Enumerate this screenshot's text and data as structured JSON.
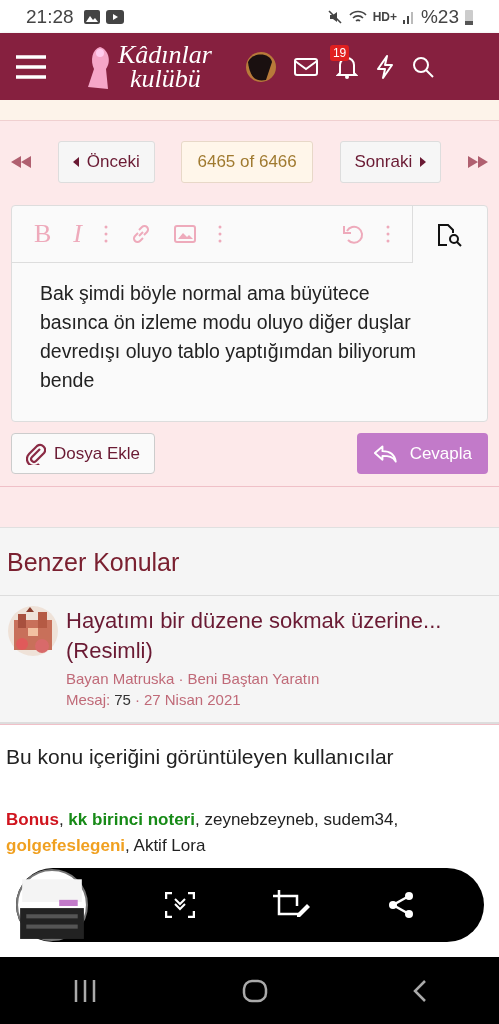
{
  "status_bar": {
    "time": "21:28",
    "network": "HD+",
    "battery": "%23"
  },
  "header": {
    "logo_line_1": "Kâdınlar",
    "logo_line_2": "kulübü",
    "notification_count": "19"
  },
  "pager": {
    "previous": "Önceki",
    "position": "6465 of 6466",
    "next": "Sonraki"
  },
  "editor": {
    "bold": "B",
    "italic": "I",
    "text": "Bak şimdi böyle normal ama büyütece basınca ön izleme modu oluyo diğer duşlar devredışı oluyo tablo yaptığımdan biliyorum bende",
    "attach": "Dosya Ekle",
    "reply": "Cevapla"
  },
  "similar": {
    "title": "Benzer Konular",
    "items": [
      {
        "kind": "picture",
        "title": "Hayatımı bir düzene sokmak üzerine... (Resimli)",
        "author": "Bayan Matruska",
        "separator_1": "·",
        "forum": "Beni Baştan Yaratın",
        "messages_label": "Mesaj:",
        "messages": "75",
        "separator_2": "·",
        "date": "27 Nisan 2021"
      }
    ]
  },
  "viewers": {
    "title": "Bu konu içeriğini görüntüleyen kullanıcılar",
    "users": [
      {
        "name": "Bonus",
        "color": "#d0141e",
        "separator": ","
      },
      {
        "name": "kk birinci noteri",
        "color": "#178a17",
        "separator": ","
      },
      {
        "name": "zeynebzeyneb",
        "color": "#222222",
        "separator": ","
      },
      {
        "name": "sudem34",
        "color": "#222222",
        "separator": ","
      },
      {
        "name": "golgefeslegeni",
        "color": "#f0a020",
        "separator": ","
      },
      {
        "name": "Aktif Lora",
        "color": "#222222"
      }
    ]
  }
}
